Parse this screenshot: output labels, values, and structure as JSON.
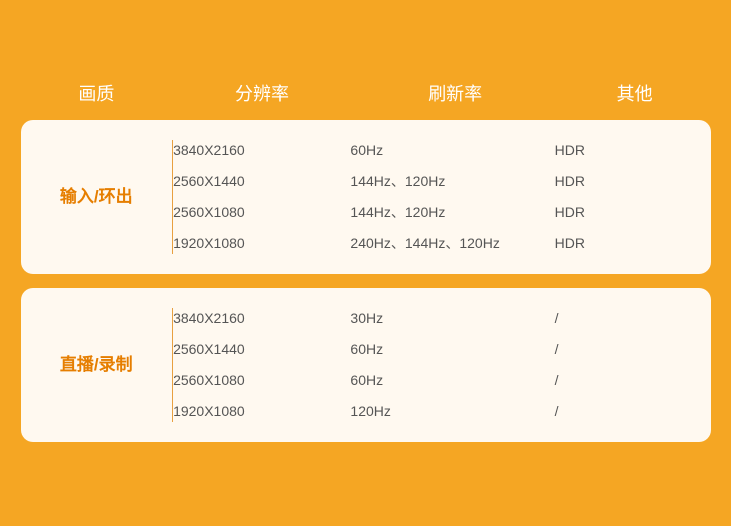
{
  "header": {
    "quality_label": "画质",
    "resolution_label": "分辨率",
    "refresh_label": "刷新率",
    "other_label": "其他"
  },
  "sections": [
    {
      "id": "input-output",
      "label": "输入/环出",
      "rows": [
        {
          "resolution": "3840X2160",
          "refresh": "60Hz",
          "other": "HDR"
        },
        {
          "resolution": "2560X1440",
          "refresh": "144Hz、120Hz",
          "other": "HDR"
        },
        {
          "resolution": "2560X1080",
          "refresh": "144Hz、120Hz",
          "other": "HDR"
        },
        {
          "resolution": "1920X1080",
          "refresh": "240Hz、144Hz、120Hz",
          "other": "HDR"
        }
      ]
    },
    {
      "id": "live-record",
      "label": "直播/录制",
      "rows": [
        {
          "resolution": "3840X2160",
          "refresh": "30Hz",
          "other": "/"
        },
        {
          "resolution": "2560X1440",
          "refresh": "60Hz",
          "other": "/"
        },
        {
          "resolution": "2560X1080",
          "refresh": "60Hz",
          "other": "/"
        },
        {
          "resolution": "1920X1080",
          "refresh": "120Hz",
          "other": "/"
        }
      ]
    }
  ]
}
